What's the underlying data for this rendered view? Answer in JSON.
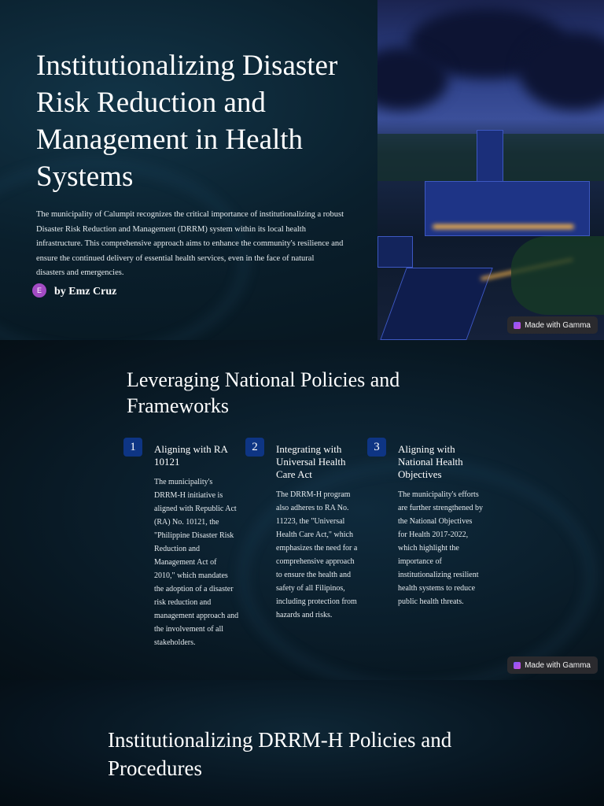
{
  "slide1": {
    "title": "Institutionalizing Disaster Risk Reduction and Management in Health Systems",
    "description": "The municipality of Calumpit recognizes the critical importance of institutionalizing a robust Disaster Risk Reduction and Management (DRRM) system within its local health infrastructure. This comprehensive approach aims to enhance the community's resilience and ensure the continued delivery of essential health services, even in the face of natural disasters and emergencies.",
    "avatar_initial": "E",
    "author": "by Emz Cruz",
    "badge": "Made with Gamma"
  },
  "slide2": {
    "title": "Leveraging National Policies and Frameworks",
    "badge": "Made with Gamma",
    "items": [
      {
        "num": "1",
        "title": "Aligning with RA 10121",
        "body": "The municipality's DRRM-H initiative is aligned with Republic Act (RA) No. 10121, the \"Philippine Disaster Risk Reduction and Management Act of 2010,\" which mandates the adoption of a disaster risk reduction and management approach and the involvement of all stakeholders."
      },
      {
        "num": "2",
        "title": "Integrating with Universal Health Care Act",
        "body": "The DRRM-H program also adheres to RA No. 11223, the \"Universal Health Care Act,\" which emphasizes the need for a comprehensive approach to ensure the health and safety of all Filipinos, including protection from hazards and risks."
      },
      {
        "num": "3",
        "title": "Aligning with National Health Objectives",
        "body": "The municipality's efforts are further strengthened by the National Objectives for Health 2017-2022, which highlight the importance of institutionalizing resilient health systems to reduce public health threats."
      }
    ]
  },
  "slide3": {
    "title": "Institutionalizing DRRM-H Policies and Procedures"
  }
}
